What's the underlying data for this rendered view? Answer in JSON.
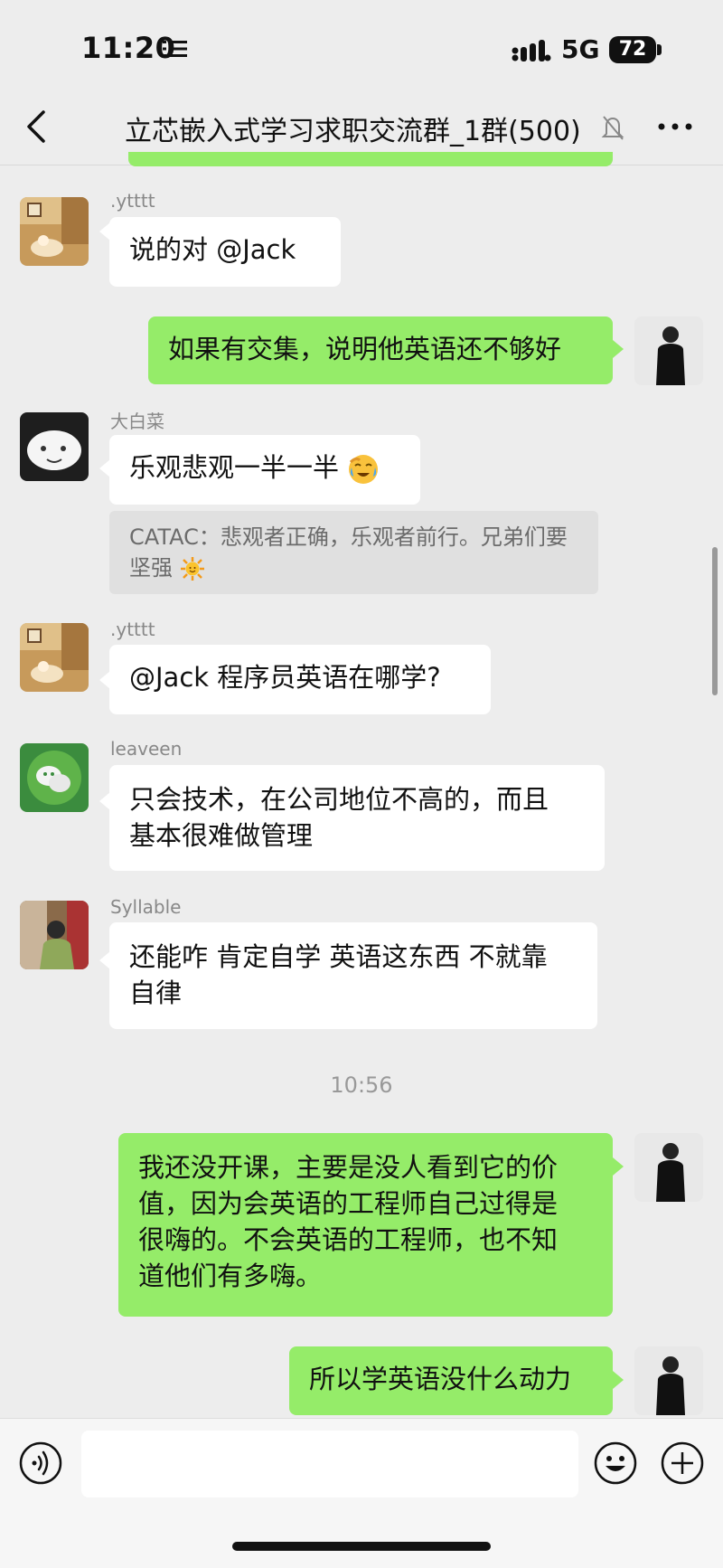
{
  "status_bar": {
    "time": "11:20",
    "network": "5G",
    "battery": "72"
  },
  "header": {
    "title": "立芯嵌入式学习求职交流群_1群(500)"
  },
  "colors": {
    "self_bubble": "#95ec69",
    "other_bubble": "#ffffff",
    "background": "#ededed"
  },
  "messages": [
    {
      "sender": ".ytttt",
      "text": "说的对  @Jack",
      "self": false
    },
    {
      "sender": "",
      "text": "如果有交集，说明他英语还不够好",
      "self": true
    },
    {
      "sender": "大白菜",
      "text": "乐观悲观一半一半",
      "emoji": "face-with-tears-icon",
      "self": false,
      "quote": "CATAC：悲观者正确，乐观者前行。兄弟们要坚强"
    },
    {
      "sender": ".ytttt",
      "text": "@Jack  程序员英语在哪学?",
      "self": false
    },
    {
      "sender": "leaveen",
      "lines": [
        "只会技术，在公司地位不高的，而且",
        "基本很难做管理"
      ],
      "self": false
    },
    {
      "sender": "Syllable",
      "lines": [
        "还能咋 肯定自学 英语这东西 不就靠",
        "自律"
      ],
      "self": false
    },
    {
      "timestamp": "10:56"
    },
    {
      "sender": "",
      "lines": [
        "我还没开课，主要是没人看到它的价",
        "值，因为会英语的工程师自己过得是",
        "很嗨的。不会英语的工程师，也不知",
        "道他们有多嗨。"
      ],
      "self": true
    },
    {
      "sender": "",
      "text": "所以学英语没什么动力",
      "self": true
    }
  ],
  "input": {
    "placeholder": ""
  }
}
